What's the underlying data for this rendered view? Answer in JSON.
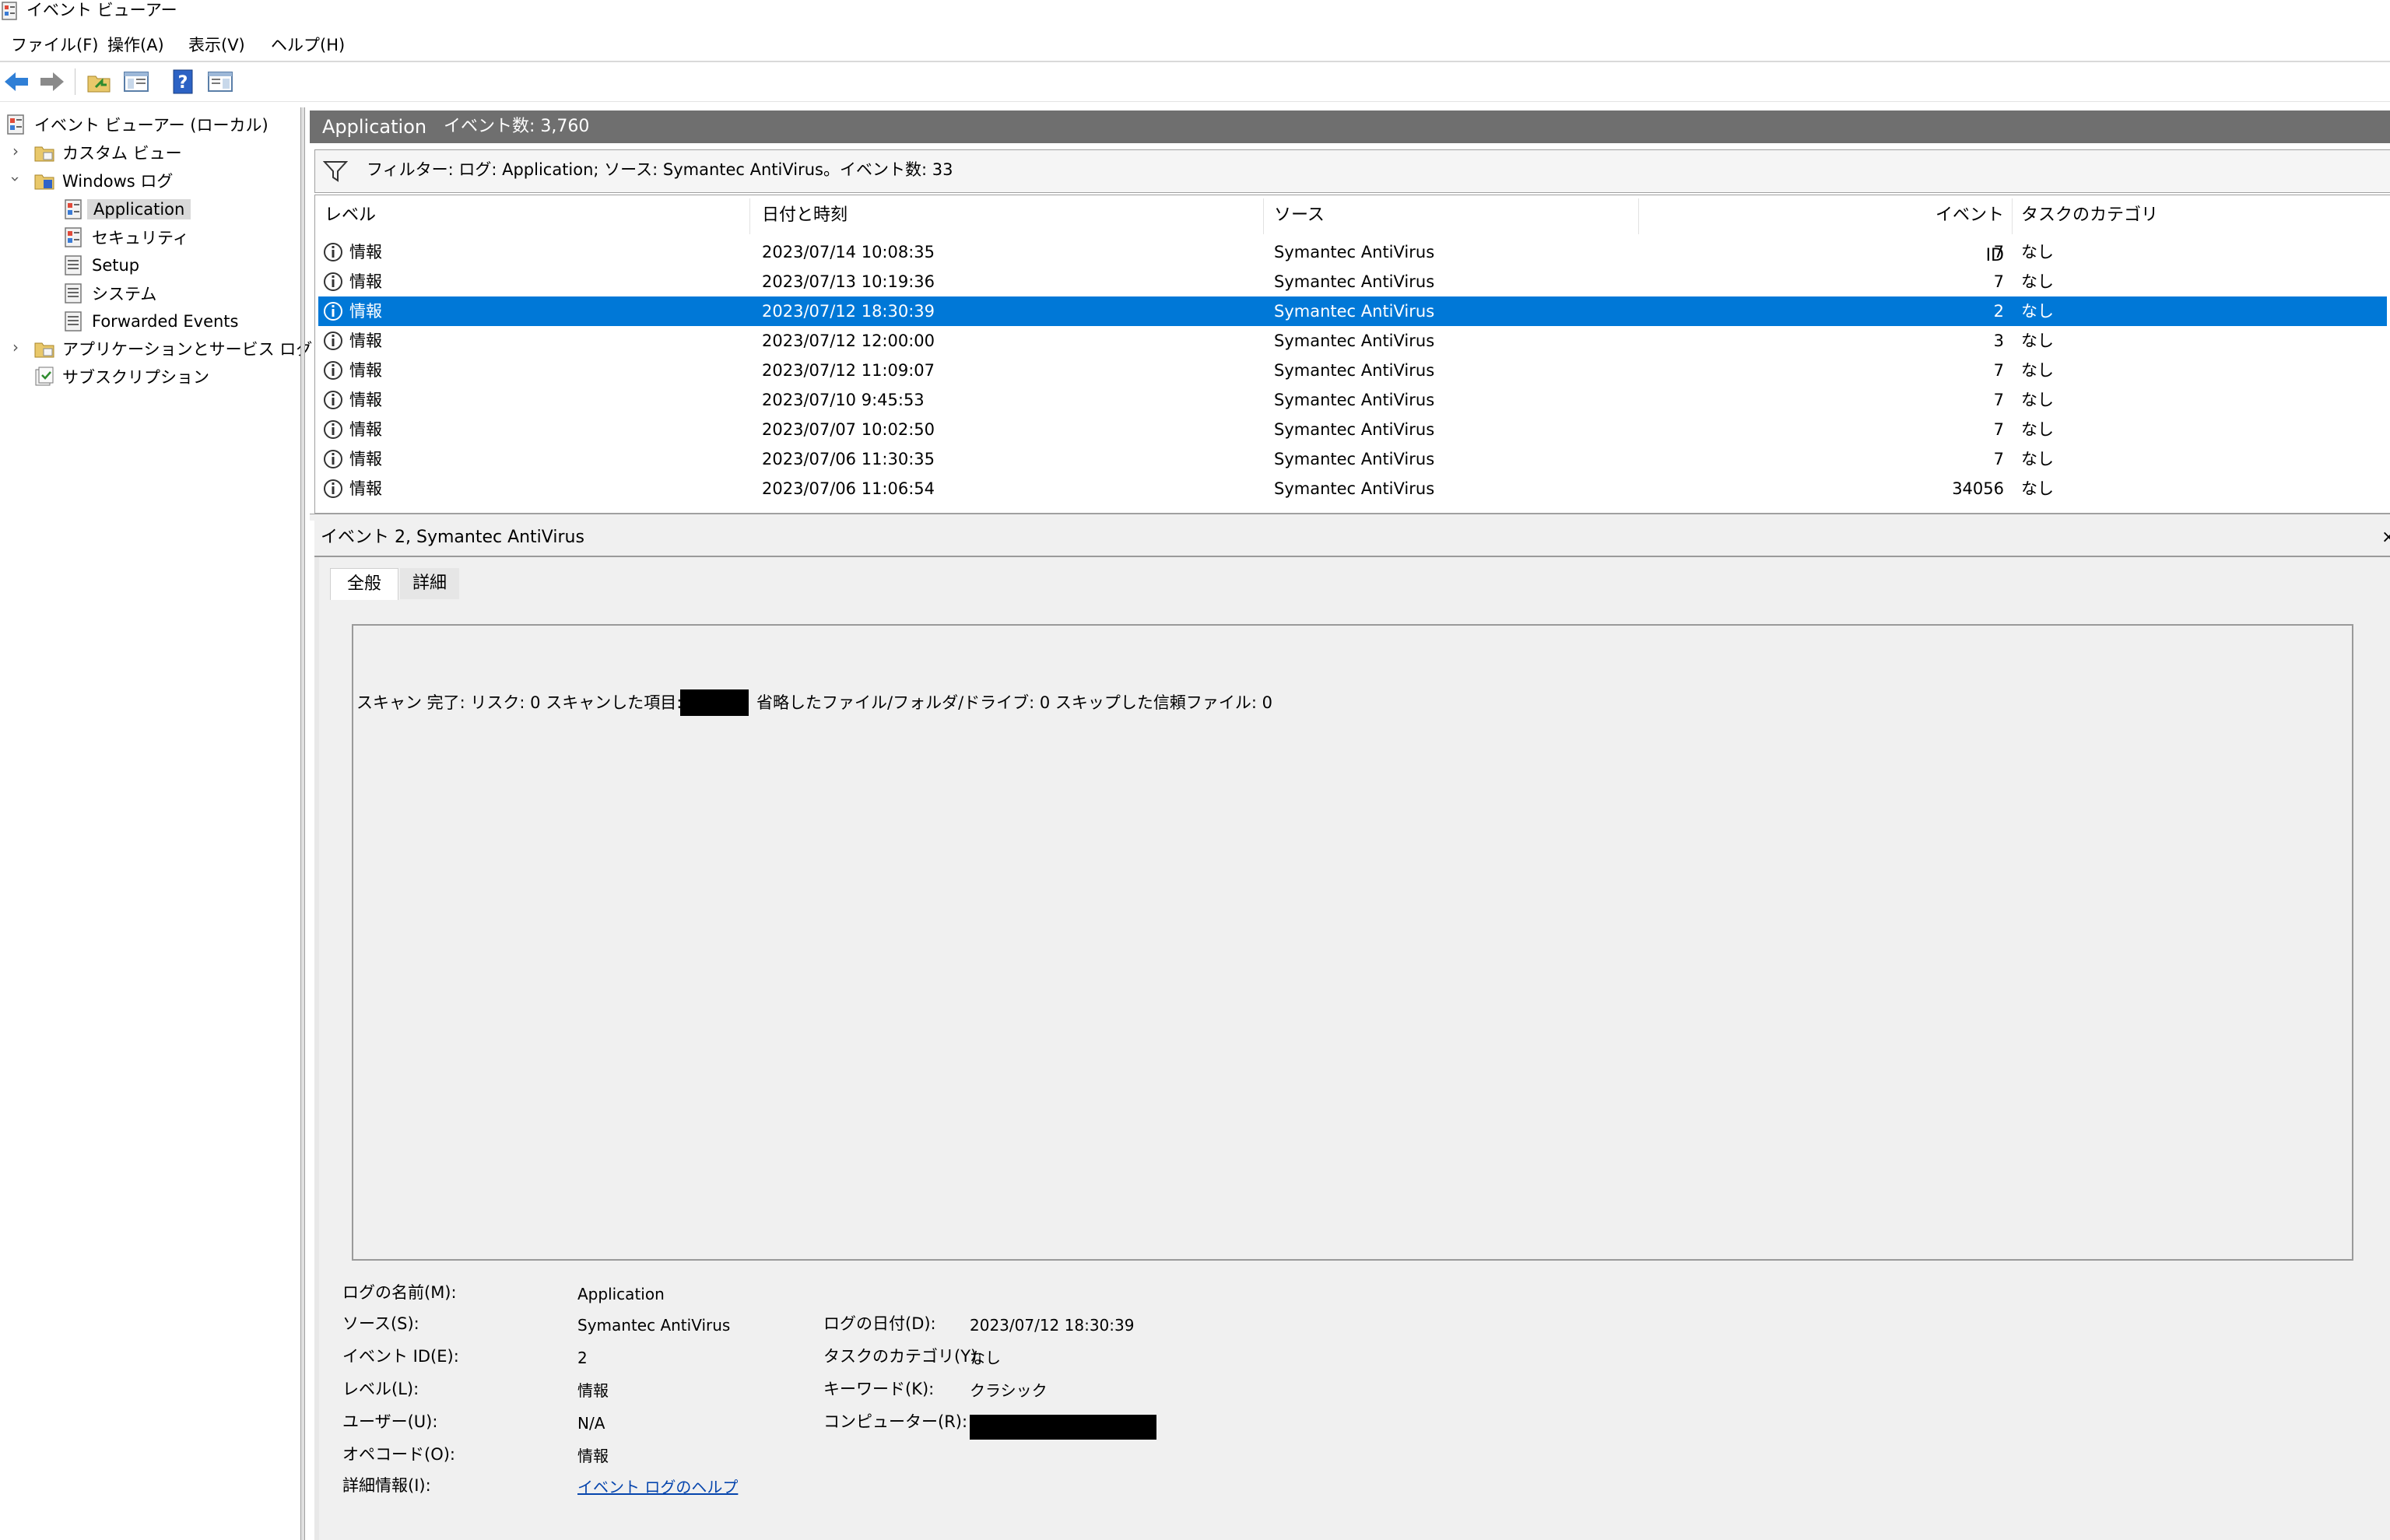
{
  "window": {
    "title": "イベント ビューアー"
  },
  "menu": [
    "ファイル(F)",
    "操作(A)",
    "表示(V)",
    "ヘルプ(H)"
  ],
  "tree": {
    "root": "イベント ビューアー (ローカル)",
    "custom_views": "カスタム ビュー",
    "windows_logs": "Windows ログ",
    "logs": [
      "Application",
      "セキュリティ",
      "Setup",
      "システム",
      "Forwarded Events"
    ],
    "app_service_logs": "アプリケーションとサービス ログ",
    "subscriptions": "サブスクリプション"
  },
  "header": {
    "log_name": "Application",
    "event_count": "イベント数: 3,760"
  },
  "filter": {
    "text": "フィルター: ログ: Application; ソース: Symantec AntiVirus。イベント数: 33"
  },
  "table": {
    "columns": [
      "レベル",
      "日付と時刻",
      "ソース",
      "イベント ID",
      "タスクのカテゴリ"
    ],
    "rows": [
      {
        "level": "情報",
        "datetime": "2023/07/14 10:08:35",
        "source": "Symantec AntiVirus",
        "id": "7",
        "category": "なし"
      },
      {
        "level": "情報",
        "datetime": "2023/07/13 10:19:36",
        "source": "Symantec AntiVirus",
        "id": "7",
        "category": "なし"
      },
      {
        "level": "情報",
        "datetime": "2023/07/12 18:30:39",
        "source": "Symantec AntiVirus",
        "id": "2",
        "category": "なし"
      },
      {
        "level": "情報",
        "datetime": "2023/07/12 12:00:00",
        "source": "Symantec AntiVirus",
        "id": "3",
        "category": "なし"
      },
      {
        "level": "情報",
        "datetime": "2023/07/12 11:09:07",
        "source": "Symantec AntiVirus",
        "id": "7",
        "category": "なし"
      },
      {
        "level": "情報",
        "datetime": "2023/07/10 9:45:53",
        "source": "Symantec AntiVirus",
        "id": "7",
        "category": "なし"
      },
      {
        "level": "情報",
        "datetime": "2023/07/07 10:02:50",
        "source": "Symantec AntiVirus",
        "id": "7",
        "category": "なし"
      },
      {
        "level": "情報",
        "datetime": "2023/07/06 11:30:35",
        "source": "Symantec AntiVirus",
        "id": "7",
        "category": "なし"
      },
      {
        "level": "情報",
        "datetime": "2023/07/06 11:06:54",
        "source": "Symantec AntiVirus",
        "id": "34056",
        "category": "なし"
      }
    ],
    "selected_index": 2
  },
  "detail": {
    "header": "イベント 2, Symantec AntiVirus",
    "close": "×",
    "tabs": [
      "全般",
      "詳細"
    ],
    "description_before": "スキャン 完了:  リスク: 0   スキャンした項目: ",
    "description_after": "省略したファイル/フォルダ/ドライブ: 0   スキップした信頼ファイル: 0",
    "fields": {
      "log_name_label": "ログの名前(M):",
      "log_name": "Application",
      "source_label": "ソース(S):",
      "source": "Symantec AntiVirus",
      "logged_label": "ログの日付(D):",
      "logged": "2023/07/12 18:30:39",
      "event_id_label": "イベント ID(E):",
      "event_id": "2",
      "task_label": "タスクのカテゴリ(Y):",
      "task": "なし",
      "level_label": "レベル(L):",
      "level": "情報",
      "keywords_label": "キーワード(K):",
      "keywords": "クラシック",
      "user_label": "ユーザー(U):",
      "user": "N/A",
      "computer_label": "コンピューター(R):",
      "opcode_label": "オペコード(O):",
      "opcode": "情報",
      "more_info_label": "詳細情報(I):",
      "more_info_link": "イベント ログのヘルプ"
    }
  }
}
